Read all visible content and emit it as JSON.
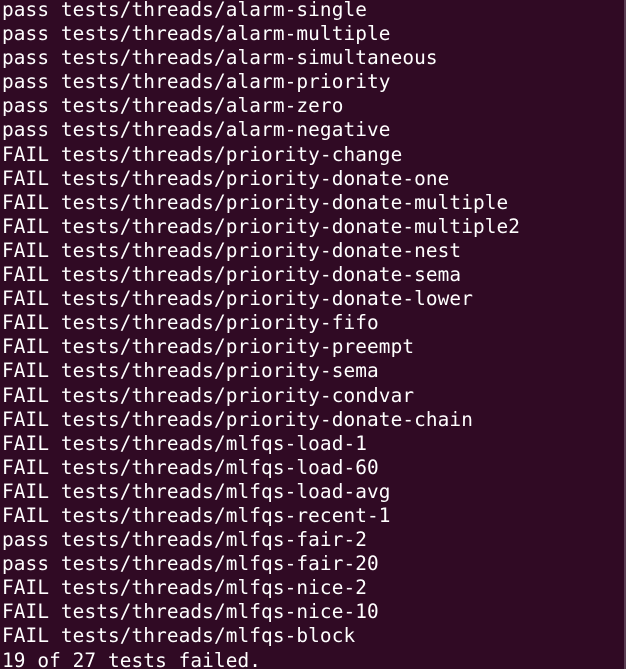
{
  "terminal": {
    "results": [
      {
        "status": "pass",
        "test": "tests/threads/alarm-single"
      },
      {
        "status": "pass",
        "test": "tests/threads/alarm-multiple"
      },
      {
        "status": "pass",
        "test": "tests/threads/alarm-simultaneous"
      },
      {
        "status": "pass",
        "test": "tests/threads/alarm-priority"
      },
      {
        "status": "pass",
        "test": "tests/threads/alarm-zero"
      },
      {
        "status": "pass",
        "test": "tests/threads/alarm-negative"
      },
      {
        "status": "FAIL",
        "test": "tests/threads/priority-change"
      },
      {
        "status": "FAIL",
        "test": "tests/threads/priority-donate-one"
      },
      {
        "status": "FAIL",
        "test": "tests/threads/priority-donate-multiple"
      },
      {
        "status": "FAIL",
        "test": "tests/threads/priority-donate-multiple2"
      },
      {
        "status": "FAIL",
        "test": "tests/threads/priority-donate-nest"
      },
      {
        "status": "FAIL",
        "test": "tests/threads/priority-donate-sema"
      },
      {
        "status": "FAIL",
        "test": "tests/threads/priority-donate-lower"
      },
      {
        "status": "FAIL",
        "test": "tests/threads/priority-fifo"
      },
      {
        "status": "FAIL",
        "test": "tests/threads/priority-preempt"
      },
      {
        "status": "FAIL",
        "test": "tests/threads/priority-sema"
      },
      {
        "status": "FAIL",
        "test": "tests/threads/priority-condvar"
      },
      {
        "status": "FAIL",
        "test": "tests/threads/priority-donate-chain"
      },
      {
        "status": "FAIL",
        "test": "tests/threads/mlfqs-load-1"
      },
      {
        "status": "FAIL",
        "test": "tests/threads/mlfqs-load-60"
      },
      {
        "status": "FAIL",
        "test": "tests/threads/mlfqs-load-avg"
      },
      {
        "status": "FAIL",
        "test": "tests/threads/mlfqs-recent-1"
      },
      {
        "status": "pass",
        "test": "tests/threads/mlfqs-fair-2"
      },
      {
        "status": "pass",
        "test": "tests/threads/mlfqs-fair-20"
      },
      {
        "status": "FAIL",
        "test": "tests/threads/mlfqs-nice-2"
      },
      {
        "status": "FAIL",
        "test": "tests/threads/mlfqs-nice-10"
      },
      {
        "status": "FAIL",
        "test": "tests/threads/mlfqs-block"
      }
    ],
    "summary": "19 of 27 tests failed."
  },
  "colors": {
    "background": "#300a24",
    "text": "#ffffff"
  }
}
